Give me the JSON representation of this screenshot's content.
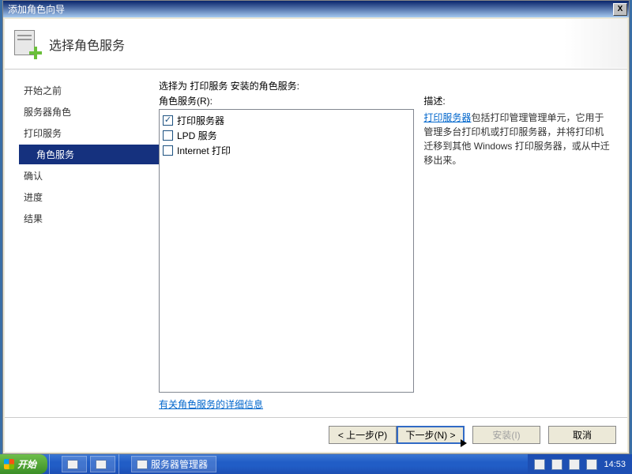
{
  "titlebar": {
    "title": "添加角色向导",
    "close": "X"
  },
  "header": {
    "title": "选择角色服务"
  },
  "nav": [
    {
      "label": "开始之前",
      "active": false,
      "indent": false
    },
    {
      "label": "服务器角色",
      "active": false,
      "indent": false
    },
    {
      "label": "打印服务",
      "active": false,
      "indent": false
    },
    {
      "label": "角色服务",
      "active": true,
      "indent": true
    },
    {
      "label": "确认",
      "active": false,
      "indent": false
    },
    {
      "label": "进度",
      "active": false,
      "indent": false
    },
    {
      "label": "结果",
      "active": false,
      "indent": false
    }
  ],
  "content": {
    "instruction": "选择为 打印服务 安装的角色服务:",
    "roles_label": "角色服务(R):",
    "roles": [
      {
        "label": "打印服务器",
        "checked": true
      },
      {
        "label": "LPD 服务",
        "checked": false
      },
      {
        "label": "Internet 打印",
        "checked": false
      }
    ],
    "desc_title": "描述:",
    "desc_link": "打印服务器",
    "desc_text": "包括打印管理管理单元，它用于管理多台打印机或打印服务器，并将打印机迁移到其他 Windows 打印服务器，或从中迁移出来。",
    "more_link": "有关角色服务的详细信息"
  },
  "footer": {
    "back": "< 上一步(P)",
    "next": "下一步(N) >",
    "install": "安装(I)",
    "cancel": "取消"
  },
  "taskbar": {
    "start": "开始",
    "task1": "服务器管理器",
    "clock": "14:53"
  }
}
